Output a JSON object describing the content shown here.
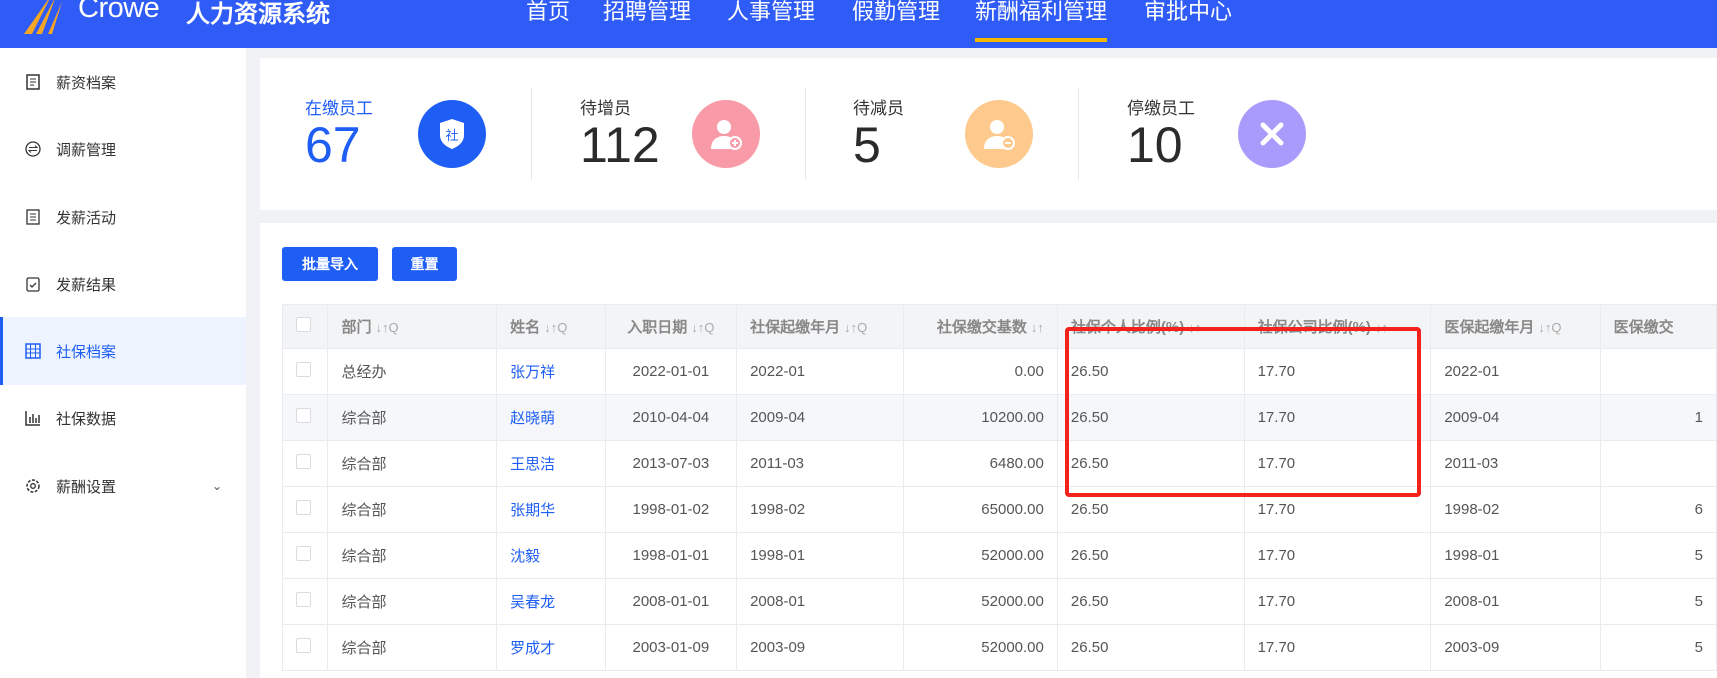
{
  "header": {
    "logo_text": "Crowe",
    "system_name": "人力资源系统",
    "nav": [
      "首页",
      "招聘管理",
      "人事管理",
      "假勤管理",
      "新酬福利管理",
      "审批中心"
    ],
    "active_nav": 4
  },
  "sidebar": {
    "items": [
      {
        "label": "薪资档案",
        "icon": "document-icon"
      },
      {
        "label": "调薪管理",
        "icon": "exchange-icon"
      },
      {
        "label": "发薪活动",
        "icon": "list-icon"
      },
      {
        "label": "发薪结果",
        "icon": "clipboard-check-icon"
      },
      {
        "label": "社保档案",
        "icon": "grid-icon",
        "active": true
      },
      {
        "label": "社保数据",
        "icon": "bar-chart-icon"
      },
      {
        "label": "薪酬设置",
        "icon": "gear-icon",
        "expandable": true
      }
    ]
  },
  "stats": [
    {
      "label": "在缴员工",
      "value": "67",
      "icon": "shield-icon",
      "icon_text": "社",
      "color": "#1e5ef5"
    },
    {
      "label": "待增员",
      "value": "112",
      "icon": "user-add-icon",
      "color": "#f99aa8"
    },
    {
      "label": "待减员",
      "value": "5",
      "icon": "user-remove-icon",
      "color": "#fdc98d"
    },
    {
      "label": "停缴员工",
      "value": "10",
      "icon": "close-icon",
      "color": "#a89bfb"
    }
  ],
  "toolbar": {
    "import_label": "批量导入",
    "reset_label": "重置"
  },
  "table": {
    "columns": [
      {
        "label": "部门",
        "sort": "↓↑Q"
      },
      {
        "label": "姓名",
        "sort": "↓↑Q"
      },
      {
        "label": "入职日期",
        "sort": "↓↑Q"
      },
      {
        "label": "社保起缴年月",
        "sort": "↓↑Q"
      },
      {
        "label": "社保缴交基数",
        "sort": "↓↑"
      },
      {
        "label": "社保个人比例(%)",
        "sort": "↓↑"
      },
      {
        "label": "社保公司比例(%)",
        "sort": "↓↑"
      },
      {
        "label": "医保起缴年月",
        "sort": "↓↑Q"
      },
      {
        "label": "医保缴交",
        "sort": ""
      }
    ],
    "rows": [
      [
        "总经办",
        "张万祥",
        "2022-01-01",
        "2022-01",
        "0.00",
        "26.50",
        "17.70",
        "2022-01",
        ""
      ],
      [
        "综合部",
        "赵晓萌",
        "2010-04-04",
        "2009-04",
        "10200.00",
        "26.50",
        "17.70",
        "2009-04",
        "1"
      ],
      [
        "综合部",
        "王思洁",
        "2013-07-03",
        "2011-03",
        "6480.00",
        "26.50",
        "17.70",
        "2011-03",
        ""
      ],
      [
        "综合部",
        "张期华",
        "1998-01-02",
        "1998-02",
        "65000.00",
        "26.50",
        "17.70",
        "1998-02",
        "6"
      ],
      [
        "综合部",
        "沈毅",
        "1998-01-01",
        "1998-01",
        "52000.00",
        "26.50",
        "17.70",
        "1998-01",
        "5"
      ],
      [
        "综合部",
        "吴春龙",
        "2008-01-01",
        "2008-01",
        "52000.00",
        "26.50",
        "17.70",
        "2008-01",
        "5"
      ],
      [
        "综合部",
        "罗成才",
        "2003-01-09",
        "2003-09",
        "52000.00",
        "26.50",
        "17.70",
        "2003-09",
        "5"
      ]
    ]
  }
}
